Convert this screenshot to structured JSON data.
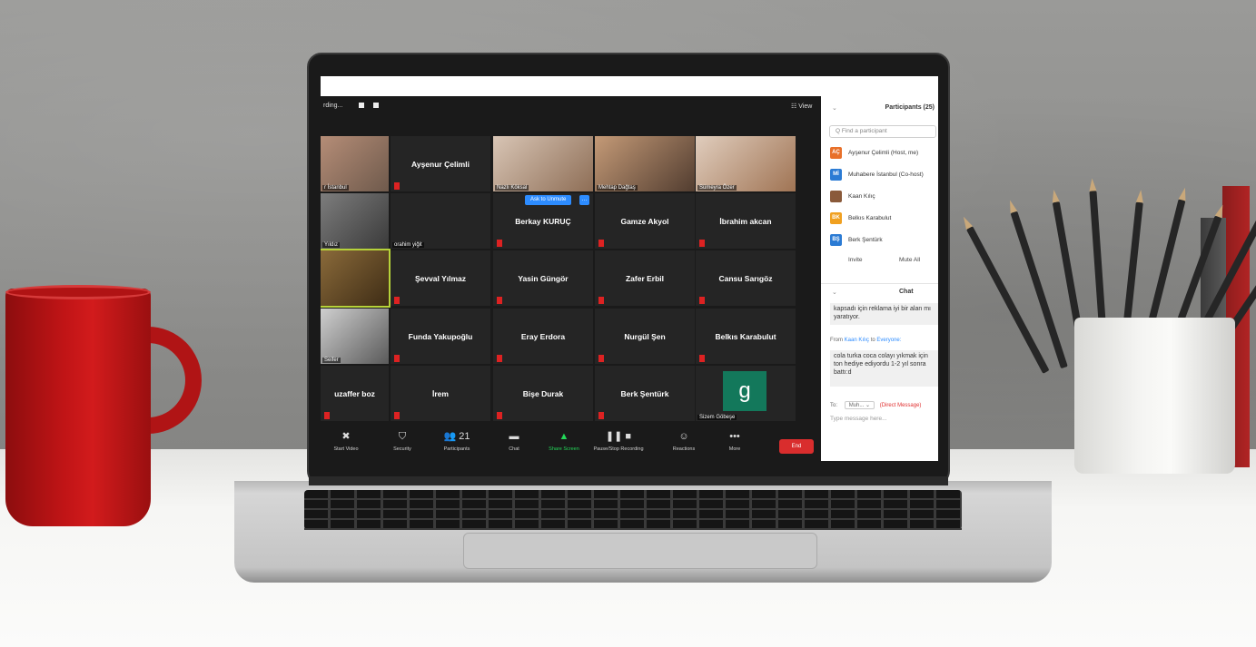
{
  "meeting": {
    "recording_label": "rding...",
    "view_label": "View",
    "unmute_label": "Ask to Unmute",
    "tiles": [
      {
        "name": "",
        "label": "r İstanbul",
        "photo": true,
        "cls": "photo"
      },
      {
        "name": "Ayşenur Çelimli",
        "label": "",
        "photo": false
      },
      {
        "name": "",
        "label": "Nazlı Köksal",
        "photo": true,
        "cls": "p2"
      },
      {
        "name": "",
        "label": "Mehtap Dağtaş",
        "photo": true,
        "cls": "p3"
      },
      {
        "name": "",
        "label": "Sümeyra Özer",
        "photo": true,
        "cls": "p4"
      },
      {
        "name": "",
        "label": "Yıldız",
        "photo": true,
        "cls": "p5"
      },
      {
        "name": "",
        "label": "orahim yiğit",
        "photo": false
      },
      {
        "name": "Berkay KURUÇ",
        "label": "",
        "photo": false
      },
      {
        "name": "Gamze Akyol",
        "label": "",
        "photo": false
      },
      {
        "name": "İbrahim akcan",
        "label": "",
        "photo": false
      },
      {
        "name": "",
        "label": "",
        "photo": true,
        "cls": "p6",
        "active": true
      },
      {
        "name": "Şevval Yılmaz",
        "label": "",
        "photo": false
      },
      {
        "name": "Yasin Güngör",
        "label": "",
        "photo": false
      },
      {
        "name": "Zafer Erbil",
        "label": "",
        "photo": false
      },
      {
        "name": "Cansu Sarıgöz",
        "label": "",
        "photo": false
      },
      {
        "name": "",
        "label": "Seifer",
        "photo": true,
        "cls": "p7"
      },
      {
        "name": "Funda Yakupoğlu",
        "label": "",
        "photo": false
      },
      {
        "name": "Eray Erdora",
        "label": "",
        "photo": false
      },
      {
        "name": "Nurgül Şen",
        "label": "",
        "photo": false
      },
      {
        "name": "Belkıs Karabulut",
        "label": "",
        "photo": false
      },
      {
        "name": "uzaffer boz",
        "label": "",
        "photo": false
      },
      {
        "name": "İrem",
        "label": "",
        "photo": false
      },
      {
        "name": "Bişe Durak",
        "label": "",
        "photo": false
      },
      {
        "name": "Berk Şentürk",
        "label": "",
        "photo": false
      },
      {
        "name": "",
        "label": "Sizem Göbeşe",
        "photo": false,
        "avatar": "g"
      }
    ],
    "toolbar": [
      {
        "key": "start-video",
        "icon": "✖",
        "label": "Start Video"
      },
      {
        "key": "security",
        "icon": "⛉",
        "label": "Security"
      },
      {
        "key": "participants",
        "icon": "👥 21",
        "label": "Participants"
      },
      {
        "key": "chat",
        "icon": "▬",
        "label": "Chat"
      },
      {
        "key": "share-screen",
        "icon": "▲",
        "label": "Share Screen",
        "green": true
      },
      {
        "key": "pause-recording",
        "icon": "❚❚ ■",
        "label": "Pause/Stop Recording"
      },
      {
        "key": "reactions",
        "icon": "☺",
        "label": "Reactions"
      },
      {
        "key": "more",
        "icon": "•••",
        "label": "More"
      }
    ],
    "end_label": "End"
  },
  "side": {
    "participants_title": "Participants (25)",
    "find_placeholder": "Q Find a participant",
    "participants": [
      {
        "initials": "AÇ",
        "name": "Ayşenur Çelimli (Host, me)",
        "color": "#e8702a"
      },
      {
        "initials": "Mİ",
        "name": "Muhabere İstanbul (Co-host)",
        "color": "#2b7bd4"
      },
      {
        "initials": "",
        "name": "Kaan Kılıç",
        "color": "#8a5a3a"
      },
      {
        "initials": "BK",
        "name": "Belkıs Karabulut",
        "color": "#f0a020"
      },
      {
        "initials": "BŞ",
        "name": "Berk Şentürk",
        "color": "#2b7bd4"
      }
    ],
    "invite_label": "Invite",
    "mute_all_label": "Mute All",
    "chat_title": "Chat",
    "msg1": "kapsadı için reklama iyi bir alan mı yaratıyor.",
    "from_prefix": "From",
    "from_name": "Kaan Kılıç",
    "to_word": "to",
    "to_name": "Everyone:",
    "msg2": "cola turka coca colayı yıkmak için ton hediye ediyordu 1-2 yıl sonra battı:d",
    "to_label": "To:",
    "to_select": "Muh...",
    "direct_label": "(Direct Message)",
    "type_placeholder": "Type message here..."
  }
}
